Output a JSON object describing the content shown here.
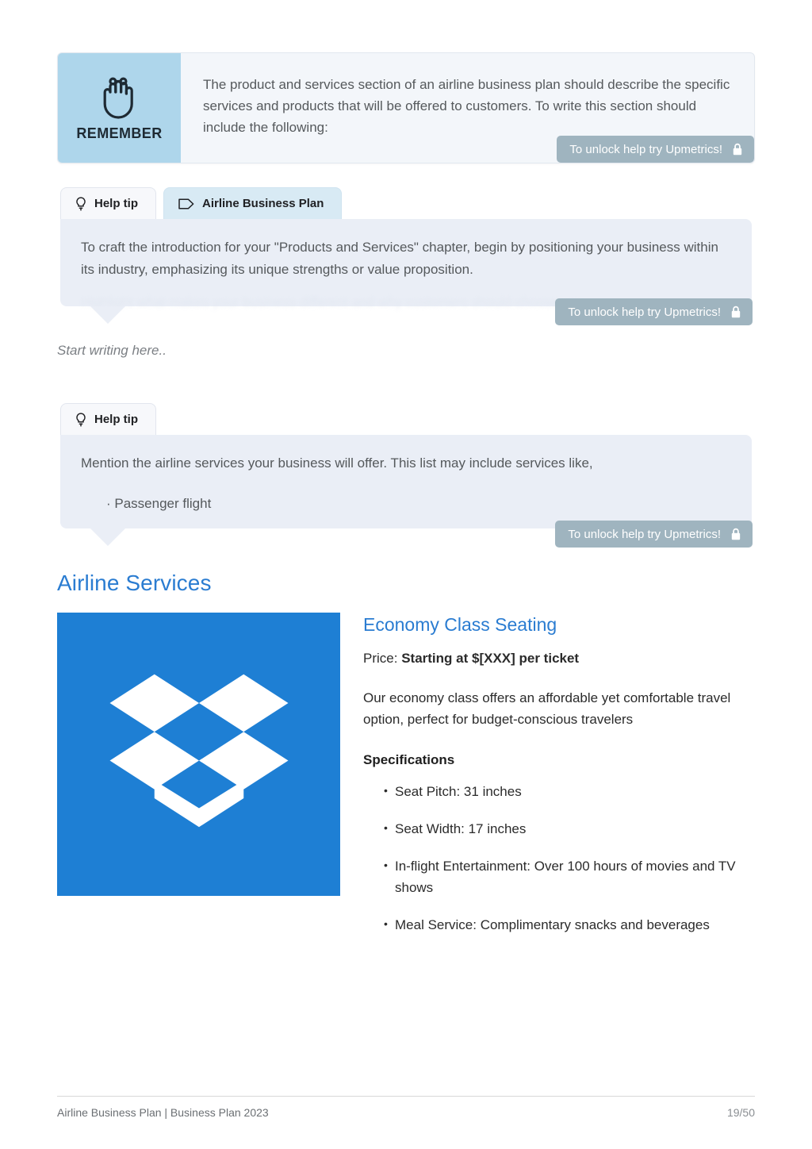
{
  "remember_callout": {
    "icon": "hand-with-string-reminder-icon",
    "label": "REMEMBER",
    "text": "The product and services section of an airline business plan should describe the specific services and products that will be offered to customers. To write this section should include the following:",
    "unlock_badge": {
      "label": "To unlock help try Upmetrics!",
      "icon": "lock-icon"
    },
    "panel_color": "#aed6eb",
    "body_color": "#f3f6fa"
  },
  "tip_block_1": {
    "tabs": [
      {
        "label": "Help tip",
        "icon": "lightbulb-icon",
        "active": false
      },
      {
        "label": "Airline Business Plan",
        "icon": "tag-icon",
        "active": true
      }
    ],
    "text": "To craft the introduction for your \"Products and Services\" chapter, begin by positioning your business within its industry, emphasizing its unique strengths or value proposition.",
    "hidden_text": "Highlight what makes your business different and why customers should choose you.",
    "unlock_badge": {
      "label": "To unlock help try Upmetrics!",
      "icon": "lock-icon"
    },
    "body_color": "#eaeef6"
  },
  "editor_placeholder": "Start writing here..",
  "tip_block_2": {
    "tabs": [
      {
        "label": "Help tip",
        "icon": "lightbulb-icon",
        "active": false
      }
    ],
    "text": "Mention the airline services your business will offer. This list may include services like,",
    "bullet": "· Passenger flight",
    "unlock_badge": {
      "label": "To unlock help try Upmetrics!",
      "icon": "lock-icon"
    },
    "body_color": "#eaeef6"
  },
  "section": {
    "heading": "Airline Services",
    "heading_color": "#2a7cd1"
  },
  "product": {
    "image": {
      "name": "dropbox-logo-image",
      "background": "#1e7fd4",
      "glyph": "dropbox-open-box-icon"
    },
    "title": "Economy Class Seating",
    "price_label": "Price:",
    "price_value": "Starting at $[XXX] per ticket",
    "description": "Our economy class offers an affordable yet comfortable travel option, perfect for budget-conscious travelers",
    "specifications_title": "Specifications",
    "specifications": [
      "Seat Pitch: 31 inches",
      "Seat Width: 17 inches",
      "In-flight Entertainment: Over 100 hours of movies and TV shows",
      "Meal Service: Complimentary snacks and beverages"
    ]
  },
  "footer": {
    "left": "Airline Business Plan | Business Plan 2023",
    "page": "19/50"
  }
}
